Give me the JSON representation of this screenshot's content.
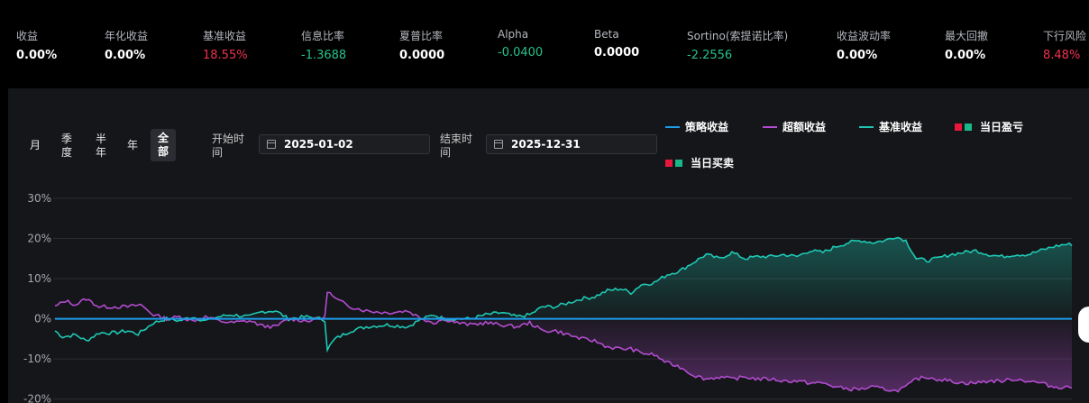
{
  "metrics": [
    {
      "label": "收益",
      "value": "0.00%",
      "tone": "neutral"
    },
    {
      "label": "年化收益",
      "value": "0.00%",
      "tone": "neutral"
    },
    {
      "label": "基准收益",
      "value": "18.55%",
      "tone": "red"
    },
    {
      "label": "信息比率",
      "value": "-1.3688",
      "tone": "green"
    },
    {
      "label": "夏普比率",
      "value": "0.0000",
      "tone": "neutral"
    },
    {
      "label": "Alpha",
      "value": "-0.0400",
      "tone": "green"
    },
    {
      "label": "Beta",
      "value": "0.0000",
      "tone": "neutral"
    },
    {
      "label": "Sortino(索提诺比率)",
      "value": "-2.2556",
      "tone": "green"
    },
    {
      "label": "收益波动率",
      "value": "0.00%",
      "tone": "neutral"
    },
    {
      "label": "最大回撤",
      "value": "0.00%",
      "tone": "neutral"
    },
    {
      "label": "下行风险",
      "value": "8.48%",
      "tone": "red"
    }
  ],
  "periods": {
    "month": "月",
    "quarter_1": "季",
    "quarter_2": "度",
    "half_1": "半",
    "half_2": "年",
    "year": "年",
    "all_1": "全",
    "all_2": "部"
  },
  "date_range": {
    "start_label_1": "开始时",
    "start_label_2": "间",
    "start_value": "2025-01-02",
    "end_label_1": "结束时",
    "end_label_2": "间",
    "end_value": "2025-12-31"
  },
  "legend": {
    "strategy": "策略收益",
    "excess": "超额收益",
    "benchmark": "基准收益",
    "daily_pnl": "当日盈亏",
    "daily_trade": "当日买卖"
  },
  "colors": {
    "strategy": "#1e9be9",
    "excess": "#b24ccf",
    "benchmark": "#1ec8b4",
    "up": "#e8173c",
    "down": "#18b889"
  },
  "chart_data": {
    "type": "line",
    "ylim": [
      -20,
      30
    ],
    "ticks": [
      "30%",
      "20%",
      "10%",
      "0%",
      "-10%",
      "-20%"
    ],
    "tick_values": [
      30,
      20,
      10,
      0,
      -10,
      -20
    ],
    "points": 250,
    "series": [
      {
        "name": "策略收益",
        "key": "strategy",
        "anchors": [
          [
            0,
            0
          ],
          [
            249,
            0
          ]
        ]
      },
      {
        "name": "基准收益",
        "key": "benchmark",
        "anchors": [
          [
            0,
            -3
          ],
          [
            3,
            -4.5
          ],
          [
            8,
            -4
          ],
          [
            12,
            -5.5
          ],
          [
            17,
            -3.5
          ],
          [
            23,
            -3.5
          ],
          [
            28,
            -3
          ],
          [
            32,
            -3.8
          ],
          [
            38,
            -1
          ],
          [
            43,
            0
          ],
          [
            48,
            -0.5
          ],
          [
            53,
            0.5
          ],
          [
            58,
            -0.5
          ],
          [
            63,
            0.5
          ],
          [
            68,
            1
          ],
          [
            75,
            0.5
          ],
          [
            80,
            1.8
          ],
          [
            85,
            2
          ],
          [
            90,
            0
          ],
          [
            97,
            0.5
          ],
          [
            102,
            0
          ],
          [
            104,
            -0.3
          ],
          [
            105,
            -7.5
          ],
          [
            108,
            -5
          ],
          [
            114,
            -3
          ],
          [
            120,
            -2
          ],
          [
            128,
            -1.5
          ],
          [
            136,
            -2
          ],
          [
            140,
            -0.5
          ],
          [
            146,
            1
          ],
          [
            150,
            0
          ],
          [
            155,
            0
          ],
          [
            160,
            0
          ],
          [
            166,
            1
          ],
          [
            172,
            1.5
          ],
          [
            178,
            0.5
          ],
          [
            183,
            1
          ],
          [
            188,
            3
          ],
          [
            193,
            3
          ],
          [
            198,
            4
          ],
          [
            203,
            5
          ],
          [
            208,
            5.5
          ],
          [
            213,
            7
          ],
          [
            218,
            7.5
          ],
          [
            222,
            6.5
          ],
          [
            226,
            8.5
          ],
          [
            231,
            9
          ],
          [
            236,
            11
          ],
          [
            241,
            12
          ],
          [
            246,
            14
          ],
          [
            251,
            16
          ],
          [
            256,
            15
          ],
          [
            261,
            16.5
          ],
          [
            266,
            15
          ],
          [
            271,
            15.5
          ],
          [
            276,
            15.5
          ],
          [
            281,
            16
          ],
          [
            286,
            15.5
          ],
          [
            291,
            17
          ],
          [
            296,
            16.5
          ],
          [
            301,
            18
          ],
          [
            306,
            19
          ],
          [
            311,
            19.5
          ],
          [
            315,
            19
          ],
          [
            320,
            19.5
          ],
          [
            324,
            20.5
          ],
          [
            328,
            19.5
          ],
          [
            332,
            15
          ],
          [
            336,
            14.5
          ],
          [
            340,
            15
          ],
          [
            345,
            16
          ],
          [
            350,
            16.5
          ],
          [
            355,
            17
          ],
          [
            360,
            16
          ],
          [
            365,
            15.5
          ],
          [
            370,
            16
          ],
          [
            375,
            16
          ],
          [
            380,
            17
          ],
          [
            385,
            18
          ],
          [
            389,
            18.5
          ],
          [
            392,
            18.55
          ]
        ]
      },
      {
        "name": "超额收益",
        "key": "excess",
        "anchors": [
          [
            0,
            3
          ],
          [
            4,
            4.5
          ],
          [
            8,
            3.5
          ],
          [
            12,
            5
          ],
          [
            17,
            3
          ],
          [
            23,
            3
          ],
          [
            28,
            3
          ],
          [
            33,
            3.5
          ],
          [
            38,
            1
          ],
          [
            43,
            0
          ],
          [
            48,
            0.5
          ],
          [
            53,
            -0.5
          ],
          [
            58,
            0.5
          ],
          [
            63,
            -0.5
          ],
          [
            68,
            -1
          ],
          [
            75,
            -0.5
          ],
          [
            80,
            -1.8
          ],
          [
            85,
            -2
          ],
          [
            90,
            0
          ],
          [
            97,
            -0.5
          ],
          [
            102,
            0
          ],
          [
            104,
            0.3
          ],
          [
            105,
            7
          ],
          [
            108,
            5
          ],
          [
            114,
            3
          ],
          [
            120,
            2
          ],
          [
            128,
            1.5
          ],
          [
            136,
            2
          ],
          [
            140,
            0.5
          ],
          [
            146,
            -1
          ],
          [
            150,
            0
          ],
          [
            155,
            -1
          ],
          [
            160,
            -1.5
          ],
          [
            166,
            -1
          ],
          [
            172,
            -1.5
          ],
          [
            178,
            -2
          ],
          [
            183,
            -1
          ],
          [
            188,
            -3
          ],
          [
            193,
            -3
          ],
          [
            198,
            -4
          ],
          [
            203,
            -5
          ],
          [
            208,
            -5.5
          ],
          [
            213,
            -7
          ],
          [
            218,
            -7.5
          ],
          [
            222,
            -7.5
          ],
          [
            226,
            -8.5
          ],
          [
            231,
            -9
          ],
          [
            236,
            -11
          ],
          [
            241,
            -12
          ],
          [
            246,
            -14
          ],
          [
            251,
            -15
          ],
          [
            256,
            -14.5
          ],
          [
            261,
            -15
          ],
          [
            266,
            -14.5
          ],
          [
            271,
            -15
          ],
          [
            276,
            -15
          ],
          [
            281,
            -15.5
          ],
          [
            286,
            -15.5
          ],
          [
            291,
            -16
          ],
          [
            296,
            -16
          ],
          [
            301,
            -17
          ],
          [
            306,
            -17.5
          ],
          [
            311,
            -17.5
          ],
          [
            315,
            -17
          ],
          [
            320,
            -17.5
          ],
          [
            324,
            -18
          ],
          [
            328,
            -17
          ],
          [
            332,
            -15
          ],
          [
            336,
            -14.5
          ],
          [
            340,
            -15
          ],
          [
            345,
            -15.5
          ],
          [
            350,
            -16
          ],
          [
            355,
            -16
          ],
          [
            360,
            -15.5
          ],
          [
            365,
            -15.5
          ],
          [
            370,
            -15
          ],
          [
            375,
            -15.5
          ],
          [
            380,
            -16
          ],
          [
            385,
            -17
          ],
          [
            389,
            -17
          ],
          [
            392,
            -17
          ]
        ]
      }
    ]
  }
}
